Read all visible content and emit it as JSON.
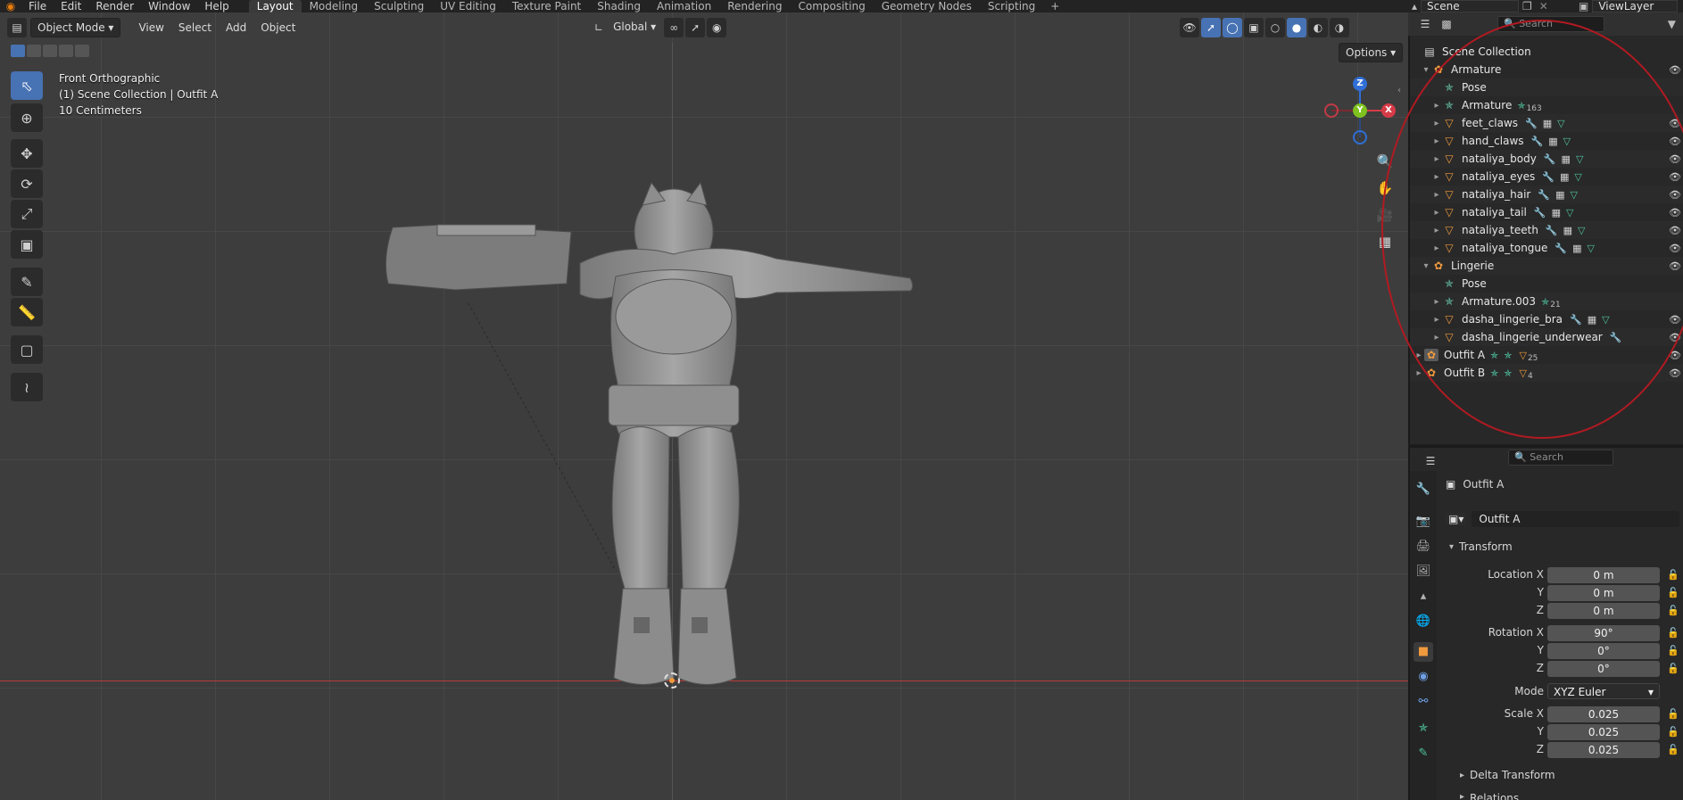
{
  "topbar": {
    "menus": [
      "File",
      "Edit",
      "Render",
      "Window",
      "Help"
    ],
    "workspaces": [
      "Layout",
      "Modeling",
      "Sculpting",
      "UV Editing",
      "Texture Paint",
      "Shading",
      "Animation",
      "Rendering",
      "Compositing",
      "Geometry Nodes",
      "Scripting"
    ],
    "active_workspace": "Layout",
    "scene_label": "Scene",
    "viewlayer_label": "ViewLayer"
  },
  "viewport": {
    "mode": "Object Mode",
    "menus": [
      "View",
      "Select",
      "Add",
      "Object"
    ],
    "transform_orientation": "Global",
    "options_label": "Options",
    "overlay_lines": [
      "Front Orthographic",
      "(1) Scene Collection | Outfit A",
      "10 Centimeters"
    ],
    "gizmo": {
      "x": "X",
      "y": "Y",
      "z": "Z"
    }
  },
  "outliner": {
    "search_placeholder": "Search",
    "root": "Scene Collection",
    "rows": [
      {
        "label": "Armature"
      },
      {
        "label": "Pose"
      },
      {
        "label": "Armature",
        "count": "163"
      },
      {
        "label": "feet_claws"
      },
      {
        "label": "hand_claws"
      },
      {
        "label": "nataliya_body"
      },
      {
        "label": "nataliya_eyes"
      },
      {
        "label": "nataliya_hair"
      },
      {
        "label": "nataliya_tail"
      },
      {
        "label": "nataliya_teeth"
      },
      {
        "label": "nataliya_tongue"
      },
      {
        "label": "Lingerie"
      },
      {
        "label": "Pose"
      },
      {
        "label": "Armature.003",
        "count": "21"
      },
      {
        "label": "dasha_lingerie_bra"
      },
      {
        "label": "dasha_lingerie_underwear"
      },
      {
        "label": "Outfit A",
        "count": "25"
      },
      {
        "label": "Outfit B",
        "count": "4"
      }
    ]
  },
  "properties": {
    "search_placeholder": "Search",
    "object_name": "Outfit A",
    "object_field": "Outfit A",
    "panel_transform": "Transform",
    "labels": {
      "loc_x": "Location X",
      "y": "Y",
      "z": "Z",
      "rot_x": "Rotation X",
      "mode": "Mode",
      "scale_x": "Scale X"
    },
    "location": [
      "0 m",
      "0 m",
      "0 m"
    ],
    "rotation": [
      "90°",
      "0°",
      "0°"
    ],
    "rotation_mode": "XYZ Euler",
    "scale": [
      "0.025",
      "0.025",
      "0.025"
    ],
    "panel_delta": "Delta Transform",
    "panel_relations": "Relations"
  }
}
